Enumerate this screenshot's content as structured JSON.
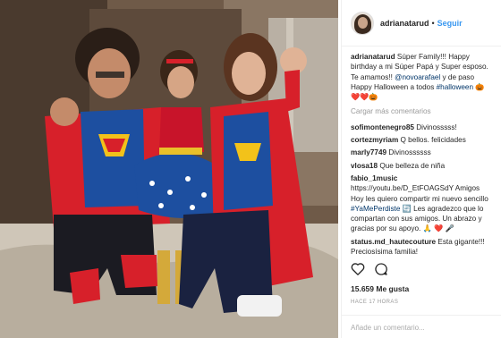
{
  "post": {
    "username": "adrianatarud",
    "follow_label": "Seguir",
    "separator": "•",
    "caption": {
      "user": "adrianatarud",
      "text_1": "Súper Family!!! Happy birthday a mi Súper Papá y Super esposo. Te amamos!! ",
      "mention": "@novoarafael",
      "text_2": " y de paso Happy Halloween a todos ",
      "hashtag": "#halloween",
      "emojis": "🎃 ❤️❤️🎃"
    },
    "load_more": "Cargar más comentarios",
    "comments": [
      {
        "user": "sofimontenegro85",
        "text": "Divinosssss!"
      },
      {
        "user": "cortezmyriam",
        "text": "Q bellos. felicidades"
      },
      {
        "user": "marly7749",
        "text": "Divinossssss"
      },
      {
        "user": "vlosa18",
        "text": "Que belleza de niña"
      }
    ],
    "long_comment": {
      "user": "fabio_1music",
      "text_1": "https://youtu.be/D_EtFOAGSdY Amigos Hoy les quiero compartir mi nuevo sencillo ",
      "hashtag": "#YaMePerdiste",
      "text_2": " 🔄 Les agradezco que lo compartan con sus amigos. Un abrazo y gracias por su apoyo. 🙏 ❤️ 🎤"
    },
    "last_comment": {
      "user": "status.md_hautecouture",
      "text": "Esta gigante!!! Preciosísima familia!"
    },
    "likes": "15.659 Me gusta",
    "time": "HACE 17 HORAS",
    "add_comment_placeholder": "Añade un comentario..."
  },
  "colors": {
    "link": "#3897f0",
    "tag": "#003569",
    "jacket_red": "#d7202a",
    "shirt_blue": "#1d4fa0"
  }
}
